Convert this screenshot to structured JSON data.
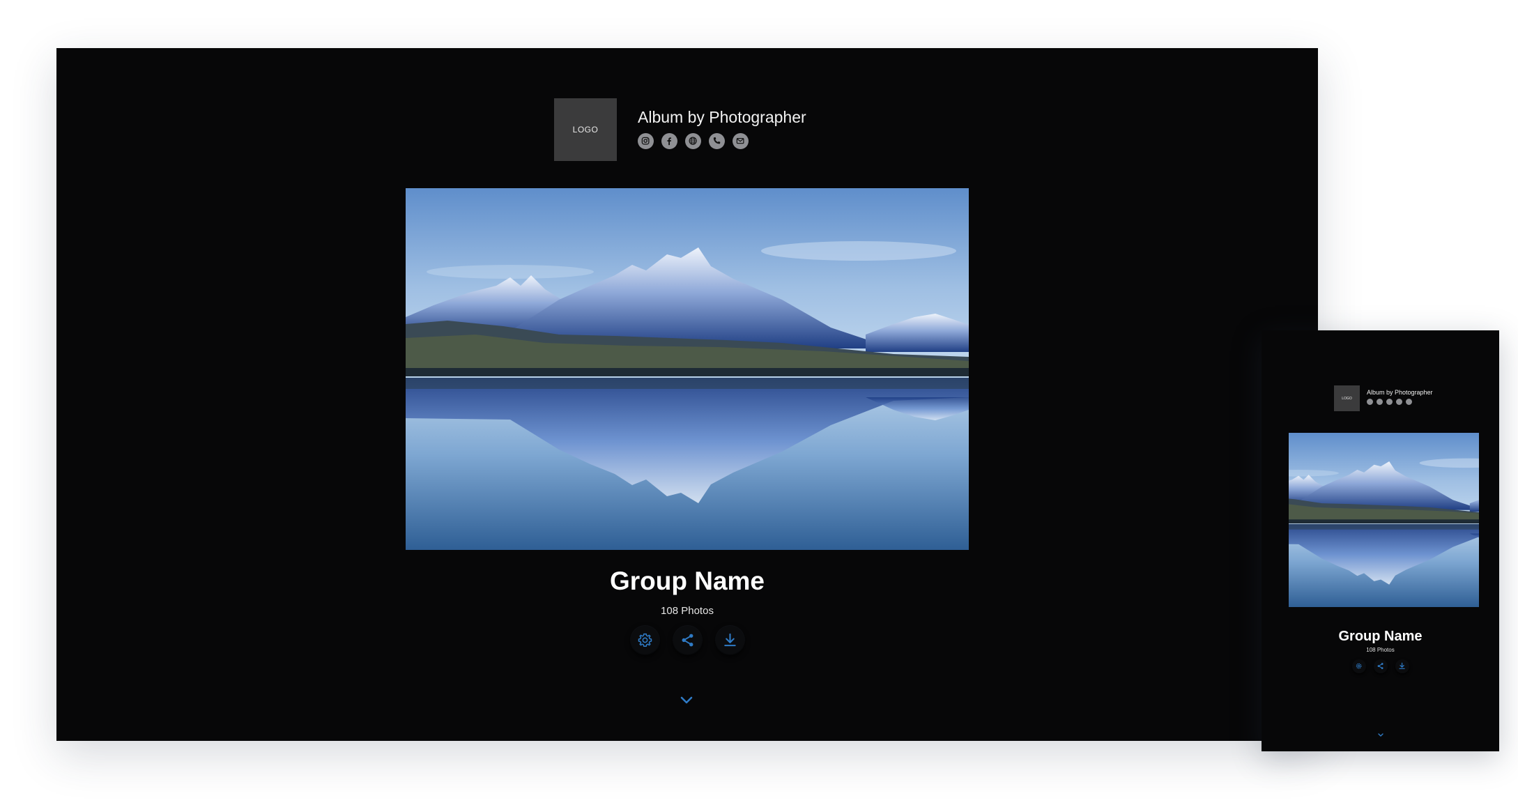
{
  "album": {
    "logo_text": "LOGO",
    "title": "Album by Photographer",
    "social_icons": [
      "instagram-icon",
      "facebook-icon",
      "website-icon",
      "phone-icon",
      "email-icon"
    ]
  },
  "group": {
    "name": "Group Name",
    "photo_count": "108 Photos"
  },
  "actions": [
    "settings-icon",
    "share-icon",
    "download-icon"
  ],
  "scroll_hint": "chevron-down-icon",
  "colors": {
    "background": "#070708",
    "accent": "#2f7bc6",
    "icon_gray": "#8f9094",
    "logo_box": "#3b3b3c",
    "text": "#ffffff"
  }
}
